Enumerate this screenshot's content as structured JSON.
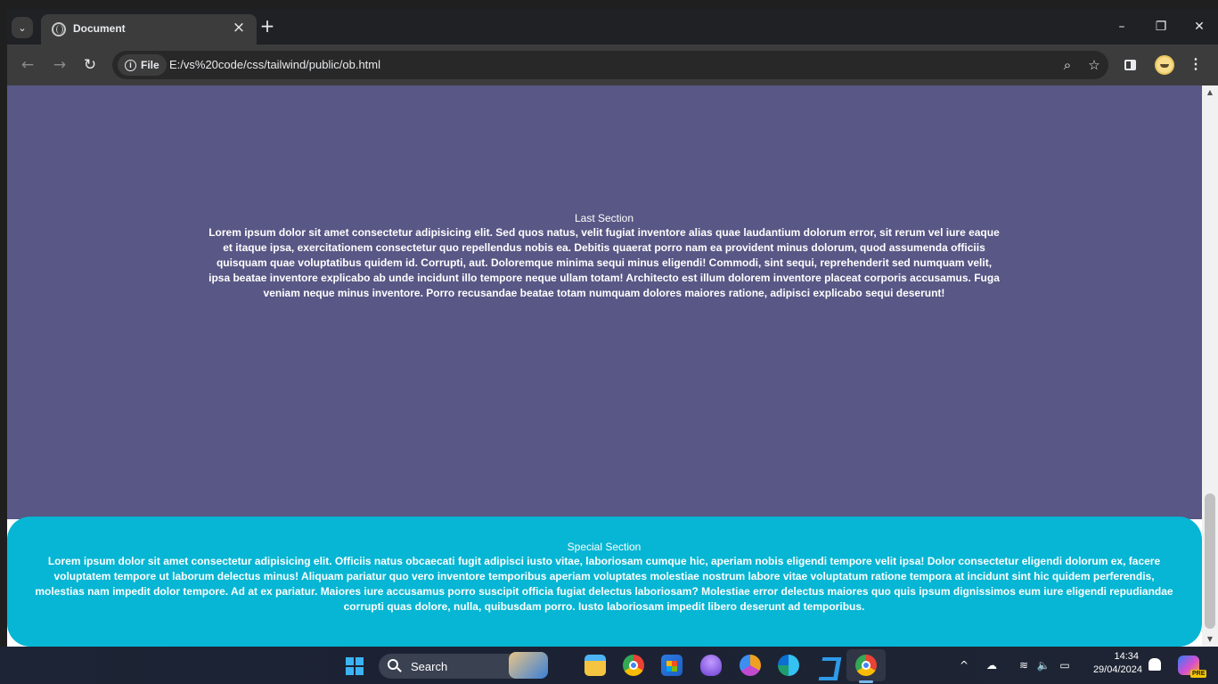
{
  "browser": {
    "tab": {
      "title": "Document"
    },
    "address": {
      "scheme_label": "File",
      "url": "E:/vs%20code/css/tailwind/public/ob.html"
    }
  },
  "page": {
    "last_section": {
      "title": "Last Section",
      "body": "Lorem ipsum dolor sit amet consectetur adipisicing elit. Sed quos natus, velit fugiat inventore alias quae laudantium dolorum error, sit rerum vel iure eaque et itaque ipsa, exercitationem consectetur quo repellendus nobis ea. Debitis quaerat porro nam ea provident minus dolorum, quod assumenda officiis quisquam quae voluptatibus quidem id. Corrupti, aut. Doloremque minima sequi minus eligendi! Commodi, sint sequi, reprehenderit sed numquam velit, ipsa beatae inventore explicabo ab unde incidunt illo tempore neque ullam totam! Architecto est illum dolorem inventore placeat corporis accusamus. Fuga veniam neque minus inventore. Porro recusandae beatae totam numquam dolores maiores ratione, adipisci explicabo sequi deserunt!",
      "background": "#585785"
    },
    "special_section": {
      "title": "Special Section",
      "body": "Lorem ipsum dolor sit amet consectetur adipisicing elit. Officiis natus obcaecati fugit adipisci iusto vitae, laboriosam cumque hic, aperiam nobis eligendi tempore velit ipsa! Dolor consectetur eligendi dolorum ex, facere voluptatem tempore ut laborum delectus minus! Aliquam pariatur quo vero inventore temporibus aperiam voluptates molestiae nostrum labore vitae voluptatum ratione tempora at incidunt sint hic quidem perferendis, molestias nam impedit dolor tempore. Ad at ex pariatur. Maiores iure accusamus porro suscipit officia fugiat delectus laboriosam? Molestiae error delectus maiores quo quis ipsum dignissimos eum iure eligendi repudiandae corrupti quas dolore, nulla, quibusdam porro. Iusto laboriosam impedit libero deserunt ad temporibus.",
      "background": "#06b6d4"
    }
  },
  "taskbar": {
    "search_label": "Search",
    "clock": {
      "time": "14:34",
      "date": "29/04/2024"
    },
    "copilot_badge": "PRE",
    "apps": [
      "file-explorer",
      "chrome",
      "microsoft-store",
      "purple-app",
      "chrome-canary",
      "edge",
      "vscode",
      "chrome"
    ]
  }
}
